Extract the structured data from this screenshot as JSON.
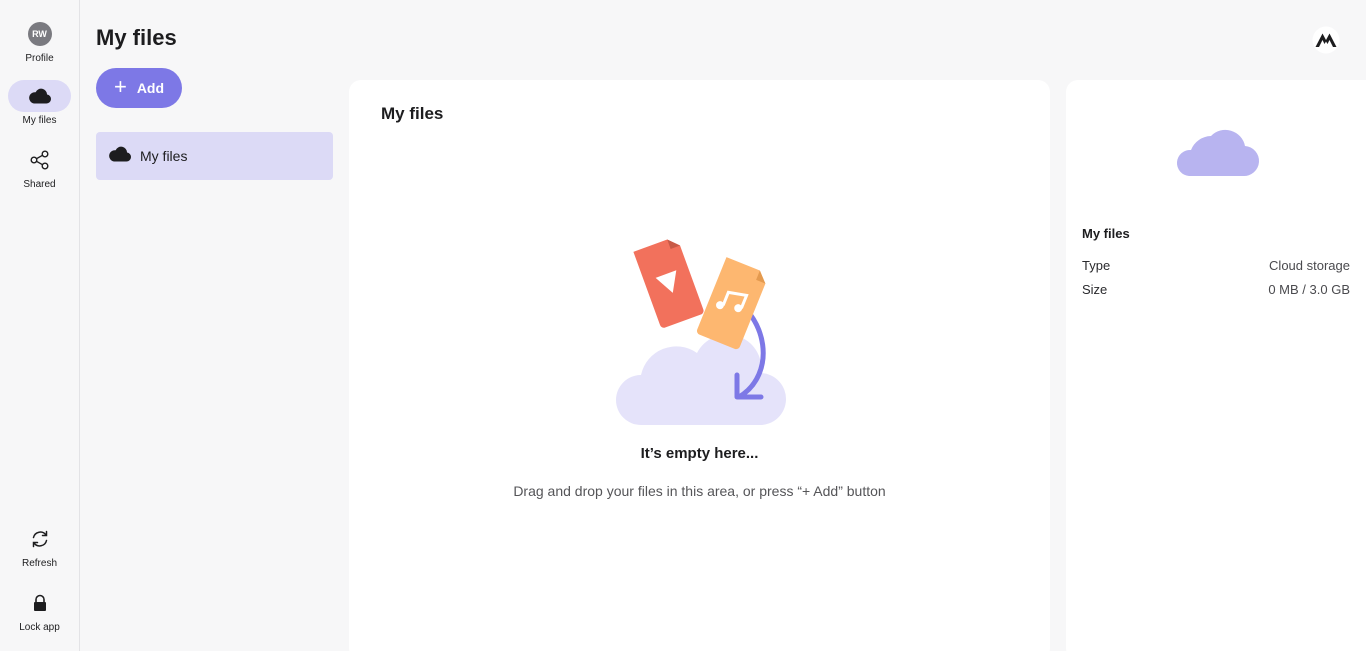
{
  "rail": {
    "profile": {
      "initials": "RW",
      "label": "Profile"
    },
    "my_files": {
      "label": "My files"
    },
    "shared": {
      "label": "Shared"
    },
    "refresh": {
      "label": "Refresh"
    },
    "lock": {
      "label": "Lock app"
    }
  },
  "header": {
    "title": "My files"
  },
  "toolbar": {
    "add_label": "Add",
    "add_icon": "plus-icon"
  },
  "folders": [
    {
      "label": "My files",
      "icon": "cloud-icon"
    }
  ],
  "main": {
    "title": "My files",
    "empty_title": "It’s empty here...",
    "empty_subtitle": "Drag and drop your files in this area, or press “+ Add” button"
  },
  "details": {
    "title": "My files",
    "rows": [
      {
        "key": "Type",
        "value": "Cloud storage"
      },
      {
        "key": "Size",
        "value": "0 MB / 3.0 GB"
      }
    ]
  },
  "colors": {
    "accent": "#7d78e6",
    "accent_light": "#dcdaf6",
    "cloud_purple": "#b8b4f0"
  }
}
